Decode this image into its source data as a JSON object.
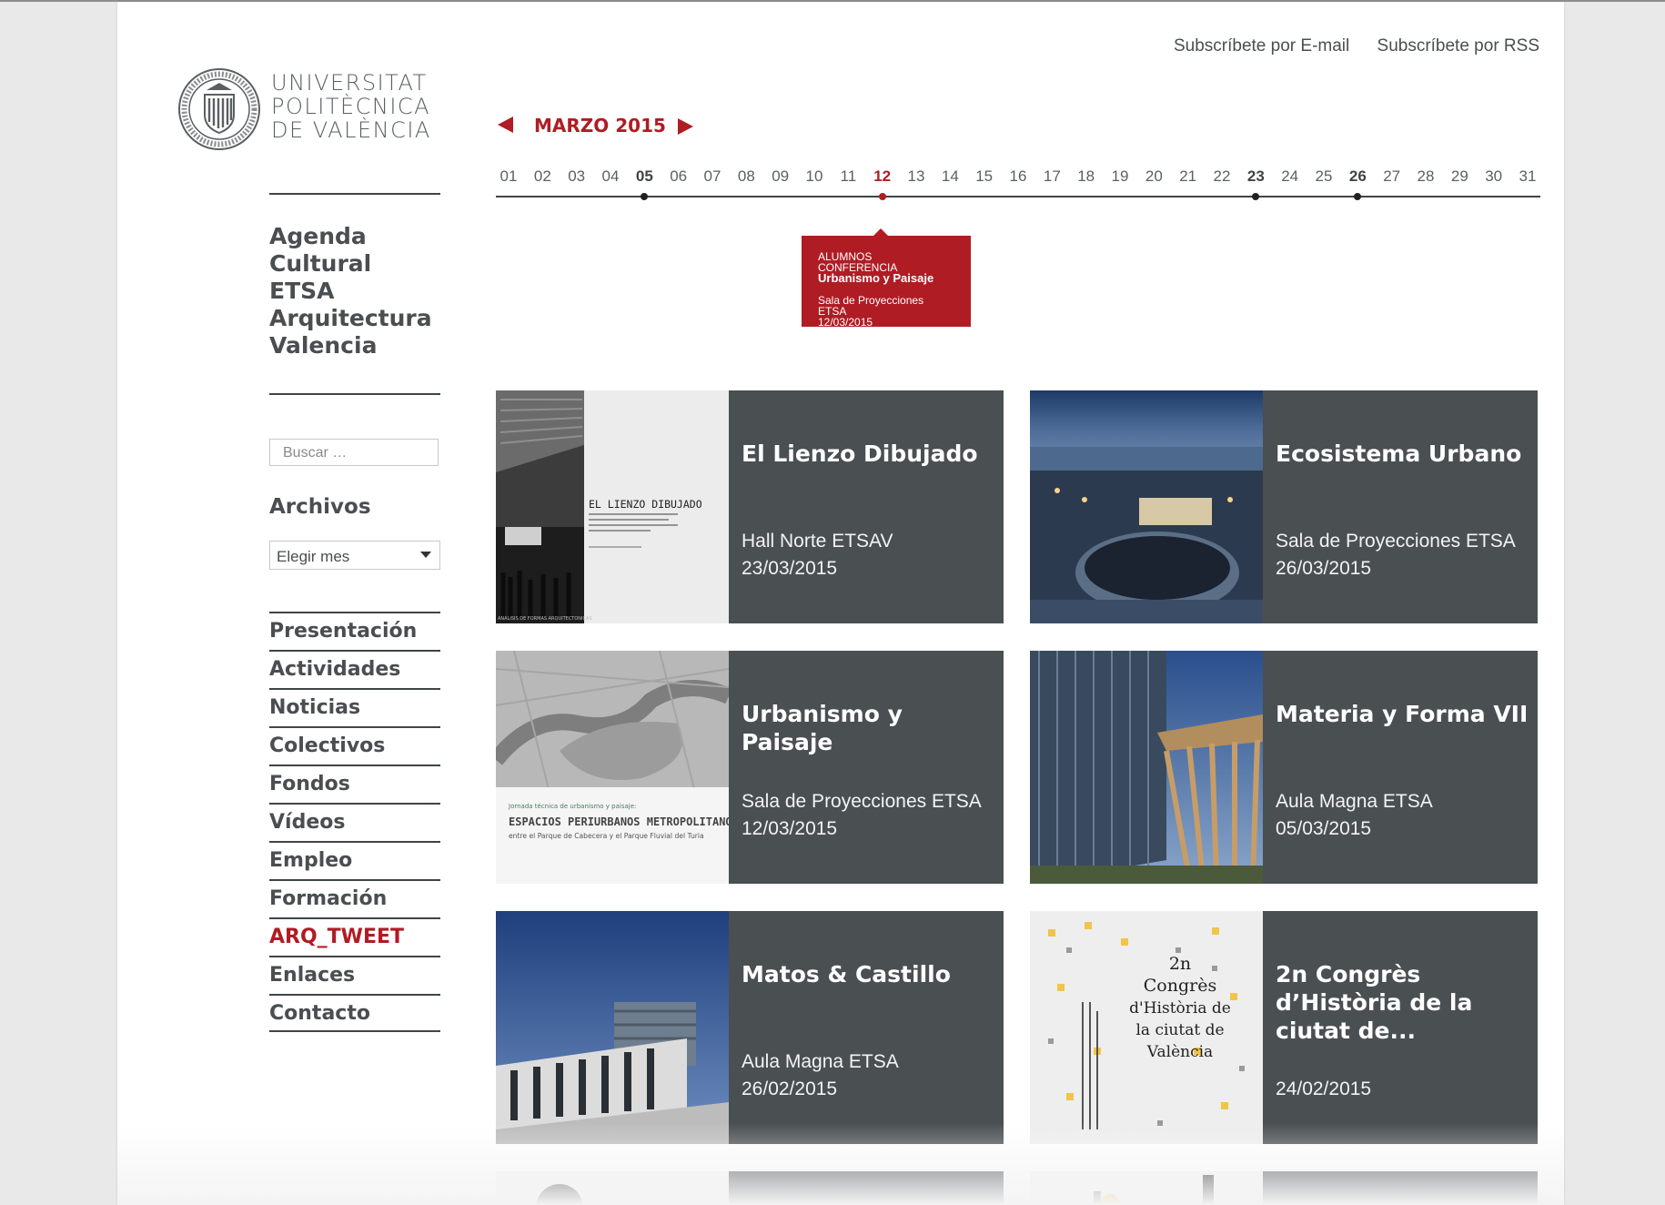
{
  "header": {
    "subscribe_email": "Subscríbete por E-mail",
    "subscribe_rss": "Subscríbete por RSS",
    "logo_line1": "UNIVERSITAT",
    "logo_line2": "POLITÈCNICA",
    "logo_line3": "DE VALÈNCIA"
  },
  "sidebar": {
    "title_lines": [
      "Agenda",
      "Cultural",
      "ETSA",
      "Arquitectura",
      "Valencia"
    ],
    "search_placeholder": "Buscar …",
    "archives_heading": "Archivos",
    "month_select": "Elegir mes",
    "menu": [
      "Presentación",
      "Actividades",
      "Noticias",
      "Colectivos",
      "Fondos",
      "Vídeos",
      "Empleo",
      "Formación",
      "ARQ_TWEET",
      "Enlaces",
      "Contacto"
    ],
    "accent_color": "#b01c24"
  },
  "calendar": {
    "month_label": "MARZO 2015",
    "days": [
      "01",
      "02",
      "03",
      "04",
      "05",
      "06",
      "07",
      "08",
      "09",
      "10",
      "11",
      "12",
      "13",
      "14",
      "15",
      "16",
      "17",
      "18",
      "19",
      "20",
      "21",
      "22",
      "23",
      "24",
      "25",
      "26",
      "27",
      "28",
      "29",
      "30",
      "31"
    ],
    "event_days": [
      "05",
      "12",
      "23",
      "26"
    ],
    "selected_day": "12",
    "tooltip": {
      "line1": "ALUMNOS CONFERENCIA",
      "line2": "Urbanismo y Paisaje",
      "line3": "Sala de Proyecciones ETSA",
      "line4": "12/03/2015"
    }
  },
  "events": [
    {
      "title": "El Lienzo Dibujado",
      "place": "Hall Norte ETSAV",
      "date": "23/03/2015",
      "poster_title": "EL LIENZO DIBUJADO",
      "poster_sub": "ANALISIS DE FORMAS ARQUITECTONICAS"
    },
    {
      "title": "Ecosistema Urbano",
      "place": "Sala de Proyecciones ETSA",
      "date": "26/03/2015"
    },
    {
      "title": "Urbanismo y Paisaje",
      "place": "Sala de Proyecciones ETSA",
      "date": "12/03/2015",
      "poster_line1": "Jornada técnica de urbanismo y paisaje:",
      "poster_line2": "ESPACIOS PERIURBANOS METROPOLITANOS:",
      "poster_line3": "entre el Parque de Cabecera y el Parque Fluvial del Turia"
    },
    {
      "title": "Materia y Forma VII",
      "place": "Aula Magna ETSA",
      "date": "05/03/2015"
    },
    {
      "title": "Matos & Castillo",
      "place": "Aula Magna ETSA",
      "date": "26/02/2015"
    },
    {
      "title": "2n Congrès d’Història de la ciutat de...",
      "place": "",
      "date": "24/02/2015",
      "poster_lines": [
        "2n",
        "Congrès",
        "d'Història de",
        "la ciutat de",
        "València"
      ]
    }
  ]
}
